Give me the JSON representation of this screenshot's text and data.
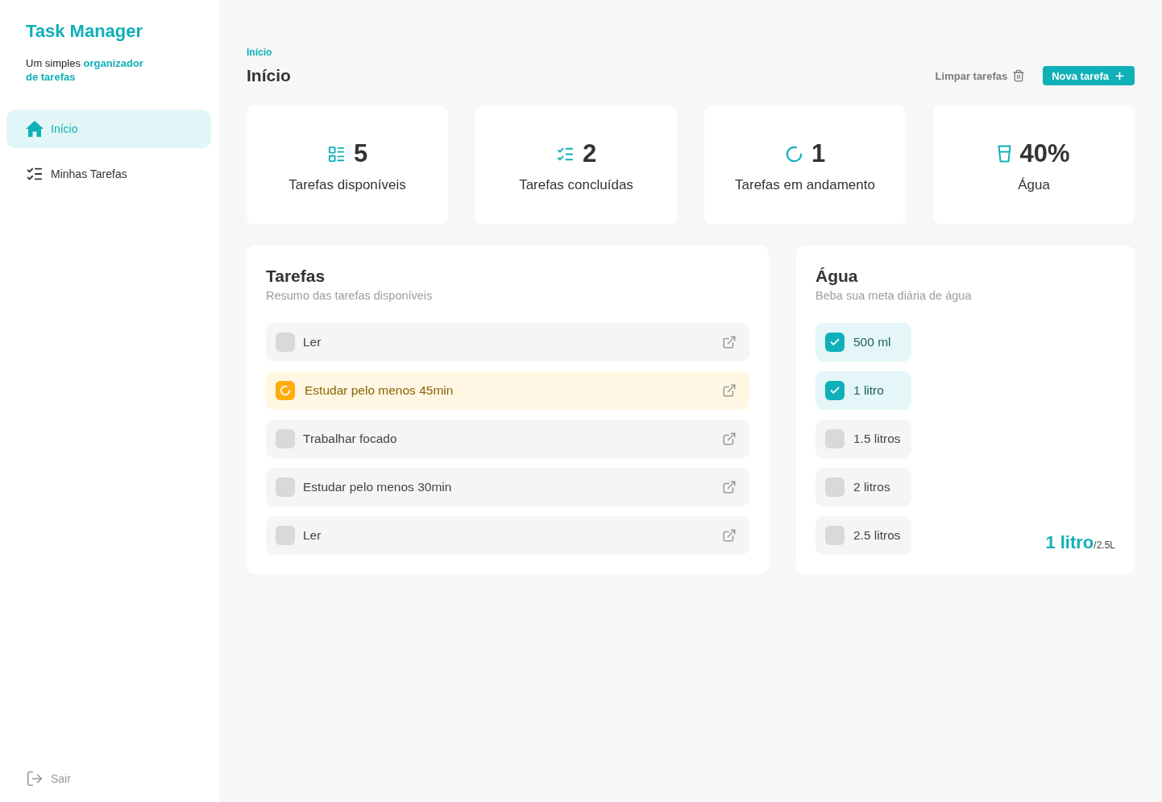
{
  "sidebar": {
    "title": "Task Manager",
    "subtitle": "Um simples **organizador de tarefas**",
    "items": [
      {
        "label": "Início",
        "kind": "home",
        "selected": true
      },
      {
        "label": "Minhas Tarefas",
        "kind": "tasks",
        "selected": false
      }
    ],
    "logout": "Sair"
  },
  "header": {
    "breadcrumb": "Início",
    "title": "Início",
    "clear_button": "Limpar tarefas",
    "new_button": "Nova tarefa"
  },
  "stats": [
    {
      "kind": "available",
      "value": "5",
      "label": "Tarefas disponíveis"
    },
    {
      "kind": "completed",
      "value": "2",
      "label": "Tarefas concluídas"
    },
    {
      "kind": "ongoing",
      "value": "1",
      "label": "Tarefas em andamento"
    },
    {
      "kind": "water",
      "value": "40%",
      "label": "Água"
    }
  ],
  "tasks": {
    "title": "Tarefas",
    "subtitle": "Resumo das tarefas disponíveis",
    "items": [
      {
        "title": "Ler",
        "in_progress": false
      },
      {
        "title": "Estudar pelo menos 45min",
        "in_progress": true
      },
      {
        "title": "Trabalhar focado",
        "in_progress": false
      },
      {
        "title": "Estudar pelo menos 30min",
        "in_progress": false
      },
      {
        "title": "Ler",
        "in_progress": false
      }
    ]
  },
  "water": {
    "title": "Água",
    "subtitle": "Beba sua meta diária de água",
    "options": [
      {
        "label": "500 ml",
        "checked": true
      },
      {
        "label": "1 litro",
        "checked": true
      },
      {
        "label": "1.5 litros",
        "checked": false
      },
      {
        "label": "2 litros",
        "checked": false
      },
      {
        "label": "2.5 litros",
        "checked": false
      }
    ],
    "total": "1 litro",
    "goal": "/2.5L"
  }
}
